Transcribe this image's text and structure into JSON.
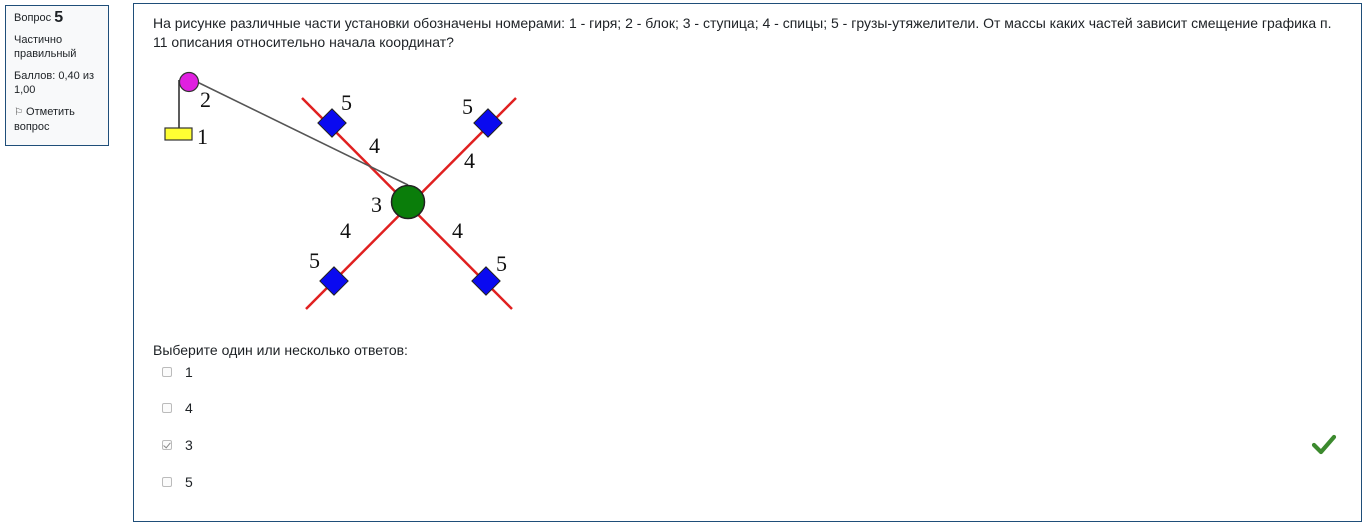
{
  "info": {
    "question_label": "Вопрос",
    "question_number": "5",
    "state": "Частично правильный",
    "grade": "Баллов: 0,40 из 1,00",
    "flag_label": "Отметить вопрос"
  },
  "question": {
    "text": "На рисунке различные части установки обозначены  номерами: 1 - гиря; 2 - блок; 3 - ступица; 4 - спицы; 5 - грузы-утяжелители. От массы каких частей зависит смещение графика п. 11 описания относительно начала координат?"
  },
  "figure": {
    "labels": {
      "weight": "1",
      "pulley": "2",
      "hub": "3",
      "spoke": "4",
      "extra_weight": "5"
    },
    "colors": {
      "pulley": "#e020e0",
      "weight": "#ffff33",
      "hub": "#0a7d0a",
      "spokes": "#e02020",
      "weights": "#0a0af0",
      "string": "#555555"
    }
  },
  "answer_prompt": "Выберите один или несколько ответов:",
  "answers": [
    {
      "label": "1",
      "checked": false
    },
    {
      "label": "4",
      "checked": false
    },
    {
      "label": "3",
      "checked": true
    },
    {
      "label": "5",
      "checked": false
    }
  ],
  "feedback": {
    "icon": "checkmark-icon",
    "color": "#3c8a2e"
  }
}
